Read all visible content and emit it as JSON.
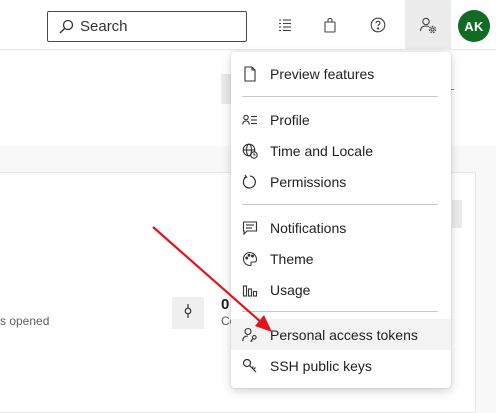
{
  "header": {
    "search_placeholder": "Search",
    "icons": [
      "search-icon",
      "task-list-icon",
      "shopping-bag-icon",
      "help-icon",
      "user-settings-icon"
    ],
    "avatar_initials": "AK",
    "avatar_color": "#116b25"
  },
  "background": {
    "opened_text": "s opened",
    "commit_count": "0",
    "commit_sub": "Co"
  },
  "menu": {
    "items": [
      {
        "label": "Preview features",
        "icon": "document-icon"
      },
      {
        "label": "Profile",
        "icon": "profile-card-icon"
      },
      {
        "label": "Time and Locale",
        "icon": "globe-clock-icon"
      },
      {
        "label": "Permissions",
        "icon": "permissions-icon"
      },
      {
        "label": "Notifications",
        "icon": "chat-icon"
      },
      {
        "label": "Theme",
        "icon": "palette-icon"
      },
      {
        "label": "Usage",
        "icon": "usage-chart-icon"
      },
      {
        "label": "Personal access tokens",
        "icon": "person-key-icon"
      },
      {
        "label": "SSH public keys",
        "icon": "key-icon"
      }
    ],
    "highlighted": "Personal access tokens"
  },
  "annotation": {
    "arrow_color": "#e3131b"
  }
}
